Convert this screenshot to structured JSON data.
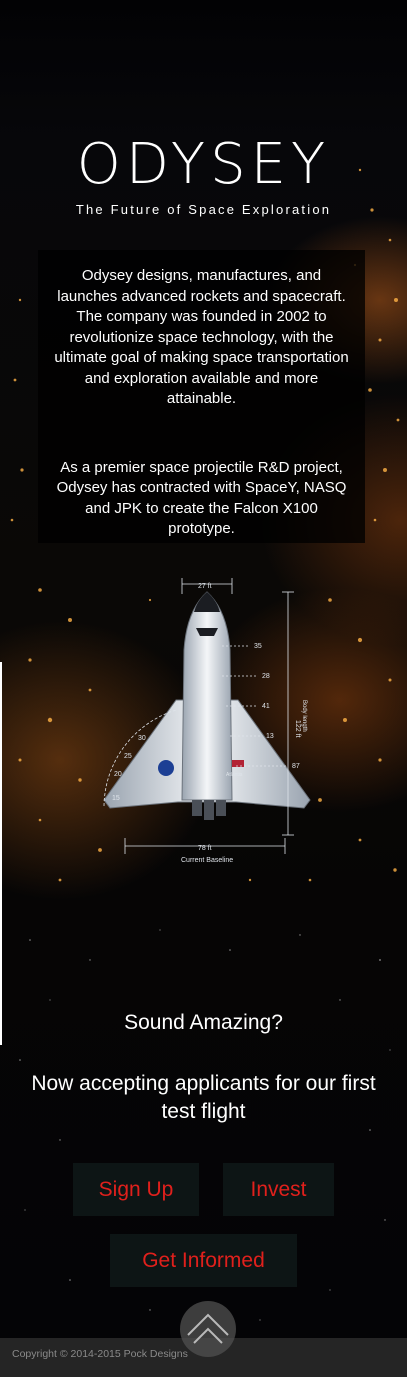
{
  "header": {
    "brand": "ODYSEY",
    "tagline": "The Future of Space Exploration"
  },
  "about": {
    "paragraph_1": "Odysey designs, manufactures, and launches advanced rockets and spacecraft. The company was founded in 2002 to revolutionize space technology, with the ultimate goal of making space transportation and exploration available and more attainable.",
    "paragraph_2": "As a premier space projectile R&D project, Odysey has contracted with SpaceY, NASQ and JPK to create the Falcon X100 prototype."
  },
  "shuttle_diagram": {
    "top_width": "27 ft",
    "bottom_width": "78 ft",
    "body_length": "122 ft",
    "body_length_label": "Body length",
    "baseline_label": "Current Baseline",
    "tail_label": "Atlantis",
    "markers": [
      "35",
      "28",
      "41",
      "13",
      "87"
    ],
    "angles": [
      "20",
      "25",
      "30",
      "15"
    ]
  },
  "closing": {
    "question": "Sound Amazing?",
    "subtitle": "Now accepting applicants for our first test flight"
  },
  "buttons": {
    "signup": "Sign Up",
    "invest": "Invest",
    "inform": "Get Informed"
  },
  "footer": {
    "copyright": "Copyright © 2014-2015 Pock Designs"
  },
  "icons": {
    "scroll_top": "chevron-up-icon"
  },
  "colors": {
    "button_text": "#e0201c",
    "button_bg": "#0d1515"
  }
}
